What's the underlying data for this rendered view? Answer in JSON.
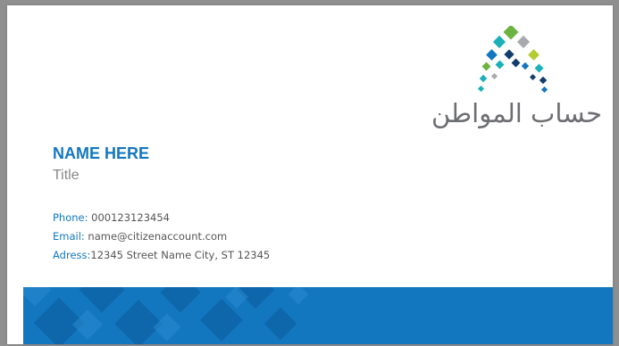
{
  "card": {
    "name": "NAME HERE",
    "title": "Title",
    "logo_text": "حساب المواطن",
    "contacts": [
      {
        "label": "Phone:",
        "value": " 000123123454"
      },
      {
        "label": "Email:",
        "value": " name@citizenaccount.com"
      },
      {
        "label": "Adress:",
        "value": "12345 Street Name City, ST 12345"
      }
    ]
  },
  "colors": {
    "brand_blue": "#1377c0",
    "band_blue": "#1377c0",
    "text_gray": "#6d6e71",
    "logo_green": "#6cb33f",
    "logo_teal": "#1ab0b8",
    "logo_navy": "#123d6e",
    "logo_gray": "#a7a9ac",
    "logo_lime": "#b5cc31"
  },
  "icons": {
    "logo": "citizen-account-diamond-arch"
  }
}
